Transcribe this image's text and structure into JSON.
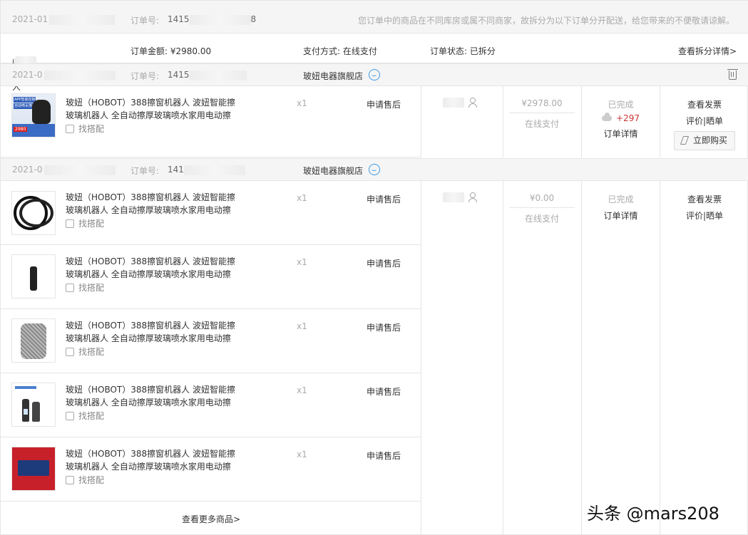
{
  "header": {
    "date": "2021-01",
    "order_no_label": "订单号:",
    "order_no_prefix": "1415",
    "order_no_suffix": "8",
    "notice": "您订单中的商品在不同库房或属不同商家，故拆分为以下订单分开配送，给您带来的不便敬请谅解。"
  },
  "summary": {
    "receiver_label": "收货人",
    "amount": "订单金额: ¥2980.00",
    "payment": "支付方式: 在线支付",
    "status": "订单状态: 已拆分",
    "split_link": "查看拆分详情>"
  },
  "suborders": [
    {
      "date": "2021-0",
      "order_no_label": "订单号:",
      "order_no_prefix": "1415",
      "shop": "玻妞电器旗舰店",
      "price": "¥2978.00",
      "pay": "在线支付",
      "status": "已完成",
      "points": "+297",
      "detail": "订单详情",
      "act1": "查看发票",
      "act2": "评价|晒单",
      "buy": "立即购买"
    },
    {
      "date": "2021-0",
      "order_no_label": "订单号:",
      "order_no_prefix": "141",
      "shop": "玻妞电器旗舰店",
      "price": "¥0.00",
      "pay": "在线支付",
      "status": "已完成",
      "detail": "订单详情",
      "act1": "查看发票",
      "act2": "评价|晒单"
    }
  ],
  "product": {
    "title": "玻妞（HOBOT）388擦窗机器人 波妞智能擦玻璃机器人 全自动擦厚玻璃喷水家用电动擦",
    "match": "找搭配",
    "qty": "x1",
    "after_sale": "申请售后"
  },
  "more_link": "查看更多商品>",
  "watermark": "头条 @mars208",
  "thumb1_badge": "APP智能控制",
  "thumb1_badge2": "自动喷水擦窗",
  "thumb1_price": "2980"
}
